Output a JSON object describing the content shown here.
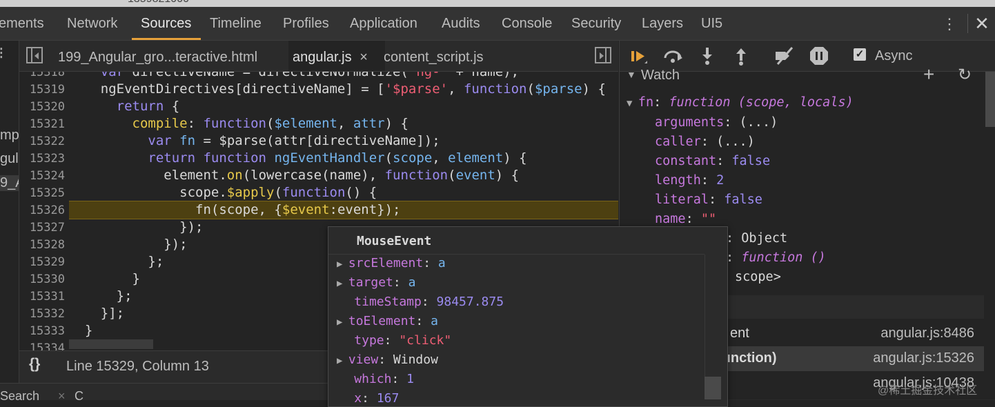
{
  "top_strip_text": "1359821000",
  "main_tabs": [
    {
      "label": "ements"
    },
    {
      "label": "Network"
    },
    {
      "label": "Sources"
    },
    {
      "label": "Timeline"
    },
    {
      "label": "Profiles"
    },
    {
      "label": "Application"
    },
    {
      "label": "Audits"
    },
    {
      "label": "Console"
    },
    {
      "label": "Security"
    },
    {
      "label": "Layers"
    },
    {
      "label": "UI5"
    }
  ],
  "navigator_fragments": [
    "mp",
    "gul",
    "9_A"
  ],
  "editor_tabs": [
    {
      "label": "199_Angular_gro...teractive.html"
    },
    {
      "label": "angular.js"
    },
    {
      "label": "content_script.js"
    }
  ],
  "editor_close_glyph": "×",
  "code": {
    "line_numbers": [
      "15318",
      "15319",
      "15320",
      "15321",
      "15322",
      "15323",
      "15324",
      "15325",
      "15326",
      "15327",
      "15328",
      "15329",
      "15330",
      "15331",
      "15332",
      "15333",
      "15334"
    ],
    "lines": [
      {
        "indent": "    ",
        "parts": [
          [
            "kw",
            "var"
          ],
          [
            "t",
            " directiveName = directiveNormalize("
          ],
          [
            "str",
            "'ng-'"
          ],
          [
            "t",
            " + name);"
          ]
        ]
      },
      {
        "indent": "    ",
        "parts": [
          [
            "t",
            "ngEventDirectives[directiveName] = ["
          ],
          [
            "str",
            "'$parse'"
          ],
          [
            "t",
            ", "
          ],
          [
            "kw",
            "function"
          ],
          [
            "t",
            "("
          ],
          [
            "prm",
            "$parse"
          ],
          [
            "t",
            ") {"
          ]
        ]
      },
      {
        "indent": "      ",
        "parts": [
          [
            "kw",
            "return"
          ],
          [
            "t",
            " {"
          ]
        ]
      },
      {
        "indent": "        ",
        "parts": [
          [
            "fnm",
            "compile"
          ],
          [
            "t",
            ": "
          ],
          [
            "kw",
            "function"
          ],
          [
            "t",
            "("
          ],
          [
            "prm",
            "$element"
          ],
          [
            "t",
            ", "
          ],
          [
            "prm",
            "attr"
          ],
          [
            "t",
            ") {"
          ]
        ]
      },
      {
        "indent": "          ",
        "parts": [
          [
            "kw",
            "var"
          ],
          [
            "t",
            " "
          ],
          [
            "prm",
            "fn"
          ],
          [
            "t",
            " = $parse(attr[directiveName]);"
          ]
        ]
      },
      {
        "indent": "          ",
        "parts": [
          [
            "kw",
            "return"
          ],
          [
            "t",
            " "
          ],
          [
            "kw",
            "function"
          ],
          [
            "t",
            " "
          ],
          [
            "prm",
            "ngEventHandler"
          ],
          [
            "t",
            "("
          ],
          [
            "prm",
            "scope"
          ],
          [
            "t",
            ", "
          ],
          [
            "prm",
            "element"
          ],
          [
            "t",
            ") {"
          ]
        ]
      },
      {
        "indent": "            ",
        "parts": [
          [
            "t",
            "element."
          ],
          [
            "fnm",
            "on"
          ],
          [
            "t",
            "(lowercase(name), "
          ],
          [
            "kw",
            "function"
          ],
          [
            "t",
            "("
          ],
          [
            "prm",
            "event"
          ],
          [
            "t",
            ") {"
          ]
        ]
      },
      {
        "indent": "              ",
        "parts": [
          [
            "t",
            "scope."
          ],
          [
            "fnm",
            "$apply"
          ],
          [
            "t",
            "("
          ],
          [
            "kw",
            "function"
          ],
          [
            "t",
            "() {"
          ]
        ]
      },
      {
        "indent": "                ",
        "parts": [
          [
            "t",
            "fn(scope, {"
          ],
          [
            "fnm",
            "$event"
          ],
          [
            "t",
            ":event});"
          ]
        ]
      },
      {
        "indent": "              ",
        "parts": [
          [
            "t",
            "});"
          ]
        ]
      },
      {
        "indent": "            ",
        "parts": [
          [
            "t",
            "});"
          ]
        ]
      },
      {
        "indent": "          ",
        "parts": [
          [
            "t",
            "};"
          ]
        ]
      },
      {
        "indent": "        ",
        "parts": [
          [
            "t",
            "}"
          ]
        ]
      },
      {
        "indent": "      ",
        "parts": [
          [
            "t",
            "};"
          ]
        ]
      },
      {
        "indent": "    ",
        "parts": [
          [
            "t",
            "}];"
          ]
        ]
      },
      {
        "indent": "  ",
        "parts": [
          [
            "t",
            "}"
          ]
        ]
      },
      {
        "indent": "",
        "parts": [
          [
            "t",
            ""
          ]
        ]
      }
    ]
  },
  "status": {
    "braces": "{}",
    "cursor_position": "Line 15329, Column 13"
  },
  "drawer_fragments": [
    "Search",
    "C"
  ],
  "debugger": {
    "async_label": "Async",
    "async_checked": "✓"
  },
  "watch": {
    "title": "Watch",
    "add": "+",
    "refresh": "↻",
    "expression_key": "fn",
    "expression_value": "function (scope, locals)",
    "properties": [
      {
        "key": "arguments",
        "value": "(...)",
        "kind": "plain"
      },
      {
        "key": "caller",
        "value": "(...)",
        "kind": "plain"
      },
      {
        "key": "constant",
        "value": "false",
        "kind": "bool"
      },
      {
        "key": "length",
        "value": "2",
        "kind": "num"
      },
      {
        "key": "literal",
        "value": "false",
        "kind": "bool"
      },
      {
        "key": "name",
        "value": "\"\"",
        "kind": "str"
      }
    ],
    "partial_rows": [
      ": Object",
      "function ()",
      "scope>"
    ]
  },
  "callstack": [
    {
      "name": "ent",
      "location": "angular.js:8486"
    },
    {
      "name": "unction)",
      "location": "angular.js:15326"
    },
    {
      "name": "",
      "location": "angular.js:10438"
    }
  ],
  "popover": {
    "title": "MouseEvent",
    "rows": [
      {
        "expand": true,
        "key": "srcElement",
        "value": "a",
        "kind": "link"
      },
      {
        "expand": true,
        "key": "target",
        "value": "a",
        "kind": "link"
      },
      {
        "expand": false,
        "key": "timeStamp",
        "value": "98457.875",
        "kind": "num"
      },
      {
        "expand": true,
        "key": "toElement",
        "value": "a",
        "kind": "link"
      },
      {
        "expand": false,
        "key": "type",
        "value": "\"click\"",
        "kind": "str"
      },
      {
        "expand": true,
        "key": "view",
        "value": "Window",
        "kind": "plain"
      },
      {
        "expand": false,
        "key": "which",
        "value": "1",
        "kind": "num"
      },
      {
        "expand": false,
        "key": "x",
        "value": "167",
        "kind": "num"
      }
    ]
  },
  "watermark": "@稀土掘金技术社区",
  "colors": {
    "accent": "#e6a13a",
    "keyword": "#9b8bf0",
    "string": "#ee5e74",
    "param": "#75b5ee",
    "function_name": "#e6c84a",
    "property": "#c678dd"
  }
}
